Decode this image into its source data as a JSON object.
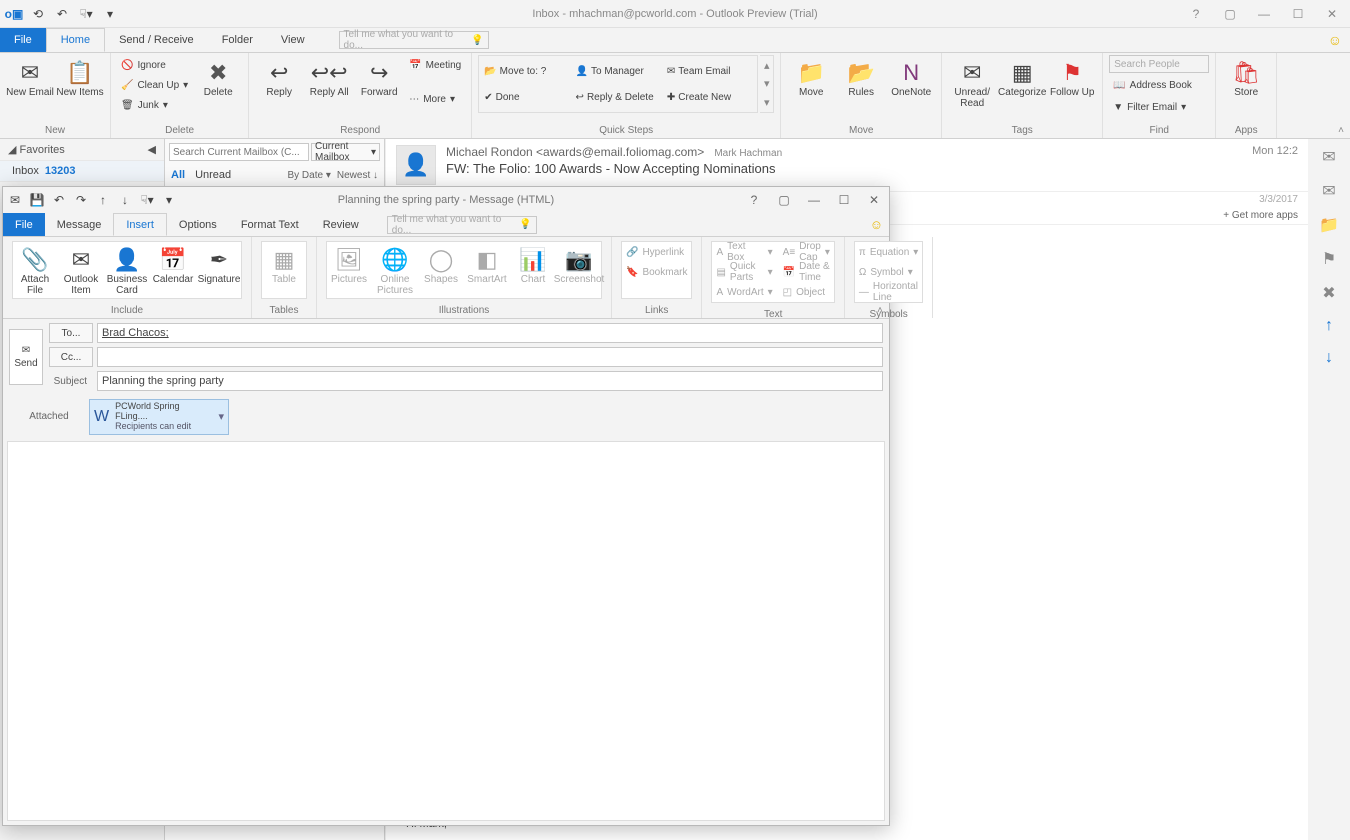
{
  "main": {
    "title": "Inbox - mhachman@pcworld.com - Outlook Preview (Trial)",
    "tabs": {
      "file": "File",
      "home": "Home",
      "sendrecv": "Send / Receive",
      "folder": "Folder",
      "view": "View"
    },
    "tellme": "Tell me what you want to do...",
    "ribbon": {
      "new": {
        "label": "New",
        "newemail": "New Email",
        "newitems": "New Items"
      },
      "delete": {
        "label": "Delete",
        "ignore": "Ignore",
        "cleanup": "Clean Up",
        "junk": "Junk",
        "delete": "Delete"
      },
      "respond": {
        "label": "Respond",
        "reply": "Reply",
        "replyall": "Reply All",
        "forward": "Forward",
        "meeting": "Meeting",
        "more": "More"
      },
      "quicksteps": {
        "label": "Quick Steps",
        "moveto": "Move to: ?",
        "tomgr": "To Manager",
        "teamemail": "Team Email",
        "done": "Done",
        "replydel": "Reply & Delete",
        "createnew": "Create New"
      },
      "move": {
        "label": "Move",
        "move": "Move",
        "rules": "Rules",
        "onenote": "OneNote"
      },
      "tags": {
        "label": "Tags",
        "unread": "Unread/ Read",
        "categorize": "Categorize",
        "followup": "Follow Up"
      },
      "find": {
        "label": "Find",
        "searchppl": "Search People",
        "address": "Address Book",
        "filter": "Filter Email"
      },
      "apps": {
        "label": "Apps",
        "store": "Store"
      }
    },
    "nav": {
      "favorites": "Favorites",
      "inbox": "Inbox",
      "inbox_count": "13203"
    },
    "list": {
      "search_ph": "Search Current Mailbox (C...",
      "scope": "Current Mailbox",
      "all": "All",
      "unread": "Unread",
      "bydate": "By Date",
      "newest": "Newest ↓"
    },
    "read": {
      "from": "Michael Rondon <awards@email.foliomag.com>",
      "to": "Mark Hachman",
      "subject": "FW: The Folio: 100 Awards - Now Accepting Nominations",
      "date_short": "Mon 12:2",
      "date_partial": "3/3/2017",
      "getapps": "+  Get more apps",
      "body_preview": "Hi Mark,"
    }
  },
  "compose": {
    "title": "Planning the spring party - Message (HTML)",
    "tabs": {
      "file": "File",
      "message": "Message",
      "insert": "Insert",
      "options": "Options",
      "format": "Format Text",
      "review": "Review"
    },
    "tellme": "Tell me what you want to do...",
    "ribbon": {
      "include": {
        "label": "Include",
        "attach": "Attach File",
        "outlookitem": "Outlook Item",
        "bizcard": "Business Card",
        "calendar": "Calendar",
        "signature": "Signature"
      },
      "tables": {
        "label": "Tables",
        "table": "Table"
      },
      "illus": {
        "label": "Illustrations",
        "pictures": "Pictures",
        "online": "Online Pictures",
        "shapes": "Shapes",
        "smartart": "SmartArt",
        "chart": "Chart",
        "screenshot": "Screenshot"
      },
      "links": {
        "label": "Links",
        "hyperlink": "Hyperlink",
        "bookmark": "Bookmark"
      },
      "text": {
        "label": "Text",
        "textbox": "Text Box",
        "quickparts": "Quick Parts",
        "wordart": "WordArt",
        "dropcap": "Drop Cap",
        "datetime": "Date & Time",
        "object": "Object"
      },
      "symbols": {
        "label": "Symbols",
        "equation": "Equation",
        "symbol": "Symbol",
        "hline": "Horizontal Line"
      }
    },
    "fields": {
      "send": "Send",
      "to": "To...",
      "cc": "Cc...",
      "subject_lbl": "Subject",
      "to_value": "Brad Chacos;",
      "subject_value": "Planning the spring party",
      "attached_lbl": "Attached",
      "attachment_name": "PCWorld Spring FLing....",
      "attachment_hint": "Recipients can edit"
    }
  }
}
